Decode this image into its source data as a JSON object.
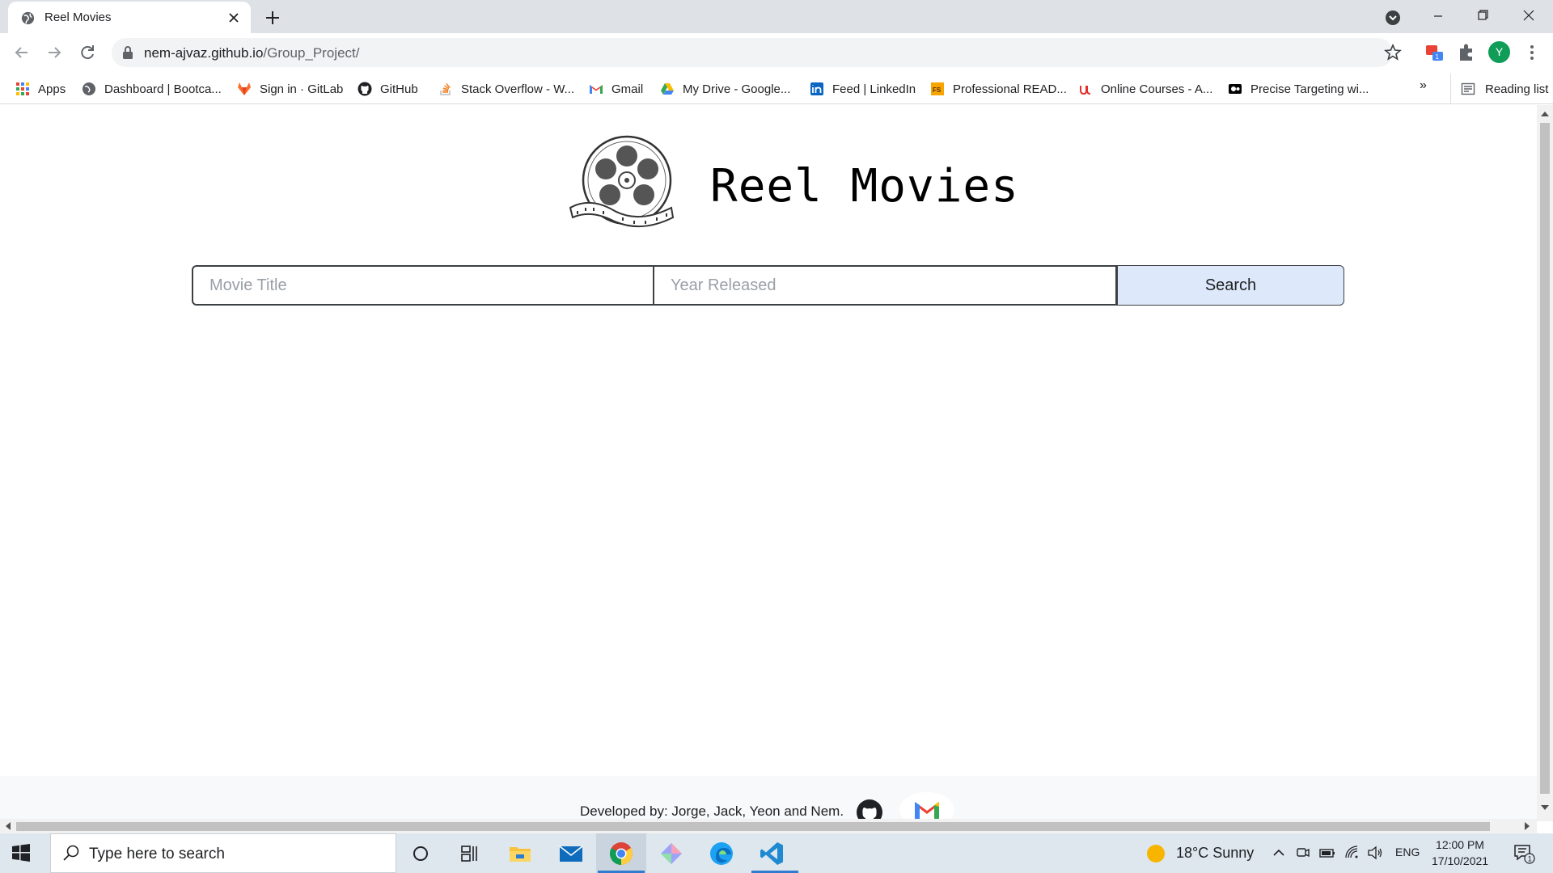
{
  "browser": {
    "tab_title": "Reel Movies",
    "url_host": "nem-ajvaz.github.io",
    "url_path": "/Group_Project/",
    "profile_initial": "Y"
  },
  "bookmarks": {
    "items": [
      {
        "label": "Apps",
        "icon": "apps-grid-icon"
      },
      {
        "label": "Dashboard | Bootca...",
        "icon": "globe-icon"
      },
      {
        "label": "Sign in · GitLab",
        "icon": "gitlab-icon"
      },
      {
        "label": "GitHub",
        "icon": "github-icon"
      },
      {
        "label": "Stack Overflow - W...",
        "icon": "stackoverflow-icon"
      },
      {
        "label": "Gmail",
        "icon": "gmail-icon"
      },
      {
        "label": "My Drive - Google...",
        "icon": "google-drive-icon"
      },
      {
        "label": "Feed | LinkedIn",
        "icon": "linkedin-icon"
      },
      {
        "label": "Professional READ...",
        "icon": "fs-icon"
      },
      {
        "label": "Online Courses - A...",
        "icon": "udemy-icon"
      },
      {
        "label": "Precise Targeting wi...",
        "icon": "camera-icon"
      }
    ],
    "overflow": "»",
    "reading_list": "Reading list"
  },
  "page": {
    "site_title": "Reel Movies",
    "search": {
      "title_placeholder": "Movie Title",
      "year_placeholder": "Year Released",
      "button_label": "Search"
    },
    "footer": {
      "credit": "Developed by: Jorge, Jack, Yeon and Nem."
    }
  },
  "taskbar": {
    "search_placeholder": "Type here to search",
    "weather": "18°C  Sunny",
    "language": "ENG",
    "time": "12:00 PM",
    "date": "17/10/2021",
    "notification_count": "1"
  },
  "colors": {
    "search_button_bg": "#dde9fb",
    "taskbar_bg": "#dfe7ee",
    "tabstrip_bg": "#dee1e6"
  }
}
